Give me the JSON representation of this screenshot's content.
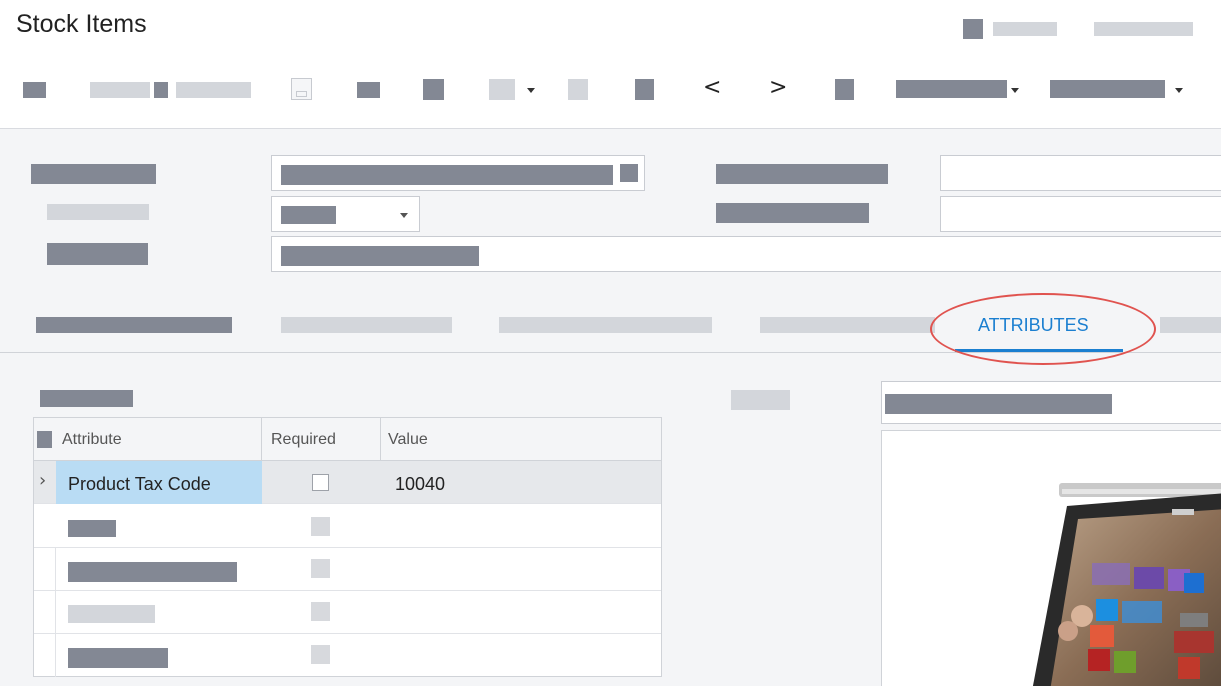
{
  "page": {
    "title": "Stock Items"
  },
  "toolbar": {
    "icons": [
      "save-icon",
      "undo-icon",
      "add-icon",
      "delete-icon",
      "copy-icon",
      "paste-icon",
      "first-record-icon",
      "prev-record-icon",
      "next-record-icon",
      "last-record-icon"
    ],
    "prev_glyph": "<",
    "next_glyph": ">"
  },
  "tabs": {
    "active_label": "ATTRIBUTES"
  },
  "attributes_grid": {
    "columns": [
      "Attribute",
      "Required",
      "Value"
    ],
    "rows": [
      {
        "attribute": "Product Tax Code",
        "required": false,
        "value": "10040"
      }
    ],
    "row_expander_glyph": "›"
  },
  "colors": {
    "accent": "#1b7fd0",
    "selection": "#b9dcf4",
    "annotation": "#e0534f"
  }
}
